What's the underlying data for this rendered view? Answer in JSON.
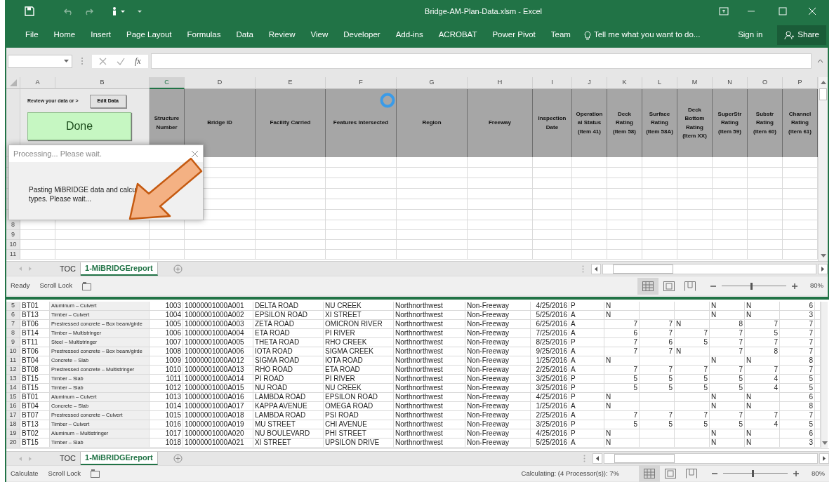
{
  "window": {
    "title": "Bridge-AM-Plan-Data.xlsm - Excel"
  },
  "ribbon": {
    "tabs": [
      "File",
      "Home",
      "Insert",
      "Page Layout",
      "Formulas",
      "Data",
      "Review",
      "View",
      "Developer",
      "Add-ins",
      "ACROBAT",
      "Power Pivot",
      "Team"
    ],
    "tell_me": "Tell me what you want to do...",
    "sign_in": "Sign in",
    "share": "Share"
  },
  "formula_bar": {
    "fx": "fx"
  },
  "top_sheet": {
    "columns": [
      {
        "letter": "A",
        "selected": false
      },
      {
        "letter": "B",
        "selected": false
      },
      {
        "letter": "C",
        "selected": true
      },
      {
        "letter": "D",
        "selected": false
      },
      {
        "letter": "E",
        "selected": false
      },
      {
        "letter": "F",
        "selected": false
      },
      {
        "letter": "G",
        "selected": false
      },
      {
        "letter": "H",
        "selected": false
      },
      {
        "letter": "I",
        "selected": false
      },
      {
        "letter": "J",
        "selected": false
      },
      {
        "letter": "K",
        "selected": false
      },
      {
        "letter": "L",
        "selected": false
      },
      {
        "letter": "M",
        "selected": false
      },
      {
        "letter": "N",
        "selected": false
      },
      {
        "letter": "O",
        "selected": false
      },
      {
        "letter": "P",
        "selected": false
      }
    ],
    "review_label": "Review your data or >",
    "edit_button": "Edit Data",
    "done_button": "Done",
    "headers": [
      {
        "lines": [
          "Structure",
          "Number"
        ]
      },
      {
        "lines": [
          "Bridge ID"
        ]
      },
      {
        "lines": [
          "Facility Carried"
        ]
      },
      {
        "lines": [
          "Features Intersected"
        ]
      },
      {
        "lines": [
          "Region"
        ]
      },
      {
        "lines": [
          "Freeway"
        ]
      },
      {
        "lines": [
          "Inspection",
          "Date"
        ]
      },
      {
        "lines": [
          "Operation",
          "al Status",
          "(Item 41)"
        ]
      },
      {
        "lines": [
          "Deck",
          "Rating",
          "(Item 58)"
        ]
      },
      {
        "lines": [
          "Surface",
          "Rating",
          "(Item 58A)"
        ]
      },
      {
        "lines": [
          "Deck",
          "Bottom",
          "Rating",
          "(Item XX)"
        ]
      },
      {
        "lines": [
          "SuperStr",
          "Rating",
          "(Item 59)"
        ]
      },
      {
        "lines": [
          "Substr",
          "Rating",
          "(Item 60)"
        ]
      },
      {
        "lines": [
          "Channel",
          "Rating",
          "(Item 61)"
        ]
      }
    ],
    "row_numbers": [
      "8",
      "9",
      "10",
      "11"
    ]
  },
  "dialog": {
    "title": "Processing... Please wait.",
    "lines": [
      "Pasting MiBRIDGE data and calcu",
      "types. Please wait..."
    ]
  },
  "top_tabs": [
    {
      "label": "TOC",
      "selected": false
    },
    {
      "label": "1-MiBRIDGEreport",
      "selected": true
    }
  ],
  "top_status": {
    "items": [
      "Ready",
      "Scroll Lock"
    ],
    "views": [
      {
        "kind": "normal",
        "selected": true
      },
      {
        "kind": "page_layout",
        "selected": false
      },
      {
        "kind": "page_break",
        "selected": false
      }
    ],
    "zoom": {
      "level": 0.45,
      "reading": "80%"
    }
  },
  "bottom_sheet": {
    "rows": [
      {
        "row": "5",
        "A": "BT01",
        "B": "Aluminum – Culvert",
        "C": "1003",
        "D": "10000001000A001",
        "E": "DELTA ROAD",
        "F": "NU CREEK",
        "G": "Northnorthwest",
        "H": "Non-Freeway",
        "I": "4/25/2016",
        "J": "P",
        "K": "N",
        "N": "N",
        "O": "N",
        "P": "6"
      },
      {
        "row": "6",
        "A": "BT13",
        "B": "Timber – Culvert",
        "C": "1004",
        "D": "10000001000A002",
        "E": "EPSILON ROAD",
        "F": "XI STREET",
        "G": "Northnorthwest",
        "H": "Non-Freeway",
        "I": "5/25/2016",
        "J": "A",
        "K": "N",
        "N": "N",
        "O": "N",
        "P": "3"
      },
      {
        "row": "7",
        "A": "BT06",
        "B": "Prestressed concrete – Box beam/girde",
        "C": "1005",
        "D": "10000001000A003",
        "E": "ZETA ROAD",
        "F": "OMICRON RIVER",
        "G": "Northnorthwest",
        "H": "Non-Freeway",
        "I": "6/25/2016",
        "J": "A",
        "K": "7",
        "L": "7",
        "M": "N",
        "N": "8",
        "O": "7",
        "P": "7"
      },
      {
        "row": "8",
        "A": "BT14",
        "B": "Timber – Multistringer",
        "C": "1006",
        "D": "10000001000A004",
        "E": "ETA ROAD",
        "F": "PI RIVER",
        "G": "Northnorthwest",
        "H": "Non-Freeway",
        "I": "7/25/2016",
        "J": "A",
        "K": "6",
        "L": "7",
        "M": "7",
        "N": "7",
        "O": "5",
        "P": "7"
      },
      {
        "row": "9",
        "A": "BT11",
        "B": "Steel – Multistringer",
        "C": "1007",
        "D": "10000001000A005",
        "E": "THETA ROAD",
        "F": "RHO CREEK",
        "G": "Northnorthwest",
        "H": "Non-Freeway",
        "I": "8/25/2016",
        "J": "P",
        "K": "7",
        "L": "6",
        "M": "5",
        "N": "7",
        "O": "7",
        "P": "7"
      },
      {
        "row": "10",
        "A": "BT06",
        "B": "Prestressed concrete – Box beam/girde",
        "C": "1008",
        "D": "10000001000A006",
        "E": "IOTA ROAD",
        "F": "SIGMA CREEK",
        "G": "Northnorthwest",
        "H": "Non-Freeway",
        "I": "9/25/2016",
        "J": "A",
        "K": "7",
        "L": "7",
        "M": "N",
        "N": "7",
        "O": "8",
        "P": "7"
      },
      {
        "row": "11",
        "A": "BT04",
        "B": "Concrete – Slab",
        "C": "1009",
        "D": "10000001000A012",
        "E": "SIGMA ROAD",
        "F": "IOTA ROAD",
        "G": "Northnorthwest",
        "H": "Non-Freeway",
        "I": "1/25/2016",
        "J": "A",
        "K": "N",
        "N": "N",
        "O": "N",
        "P": "8"
      },
      {
        "row": "12",
        "A": "BT08",
        "B": "Prestressed concrete – Multistringer",
        "C": "1010",
        "D": "10000001000A013",
        "E": "RHO ROAD",
        "F": "ETA ROAD",
        "G": "Northnorthwest",
        "H": "Non-Freeway",
        "I": "2/25/2016",
        "J": "A",
        "K": "7",
        "L": "7",
        "M": "7",
        "N": "7",
        "O": "7",
        "P": "7"
      },
      {
        "row": "13",
        "A": "BT15",
        "B": "Timber – Slab",
        "C": "1011",
        "D": "10000001000A014",
        "E": "PI ROAD",
        "F": "PI RIVER",
        "G": "Northnorthwest",
        "H": "Non-Freeway",
        "I": "3/25/2016",
        "J": "P",
        "K": "5",
        "L": "5",
        "M": "5",
        "N": "5",
        "O": "4",
        "P": "5"
      },
      {
        "row": "14",
        "A": "BT15",
        "B": "Timber – Slab",
        "C": "1012",
        "D": "10000001000A015",
        "E": "NU ROAD",
        "F": "NU CREEK",
        "G": "Northnorthwest",
        "H": "Non-Freeway",
        "I": "3/25/2016",
        "J": "P",
        "K": "5",
        "L": "5",
        "M": "5",
        "N": "5",
        "O": "4",
        "P": "5"
      },
      {
        "row": "15",
        "A": "BT01",
        "B": "Aluminum – Culvert",
        "C": "1013",
        "D": "10000001000A016",
        "E": "LAMBDA ROAD",
        "F": "EPSILON ROAD",
        "G": "Northnorthwest",
        "H": "Non-Freeway",
        "I": "4/25/2016",
        "J": "P",
        "K": "N",
        "N": "N",
        "O": "N",
        "P": "6"
      },
      {
        "row": "16",
        "A": "BT04",
        "B": "Concrete – Slab",
        "C": "1014",
        "D": "10000001000A017",
        "E": "KAPPA AVENUE",
        "F": "OMEGA ROAD",
        "G": "Northnorthwest",
        "H": "Non-Freeway",
        "I": "1/25/2016",
        "J": "A",
        "K": "N",
        "N": "N",
        "O": "N",
        "P": "8"
      },
      {
        "row": "17",
        "A": "BT07",
        "B": "Prestressed concrete – Culvert",
        "C": "1015",
        "D": "10000001000A018",
        "E": "LAMBDA ROAD",
        "F": "PSI ROAD",
        "G": "Northnorthwest",
        "H": "Non-Freeway",
        "I": "2/25/2016",
        "J": "A",
        "K": "7",
        "L": "7",
        "M": "7",
        "N": "7",
        "O": "7",
        "P": "7"
      },
      {
        "row": "18",
        "A": "BT13",
        "B": "Timber – Culvert",
        "C": "1016",
        "D": "10000001000A019",
        "E": "MU STREET",
        "F": "CHI AVENUE",
        "G": "Northnorthwest",
        "H": "Non-Freeway",
        "I": "3/25/2016",
        "J": "P",
        "K": "5",
        "L": "5",
        "M": "5",
        "N": "5",
        "O": "4",
        "P": "5"
      },
      {
        "row": "19",
        "A": "BT02",
        "B": "Aluminum – Multistringer",
        "C": "1017",
        "D": "10000001000A020",
        "E": "NU BOULEVARD",
        "F": "PHI STREET",
        "G": "Northnorthwest",
        "H": "Non-Freeway",
        "I": "4/25/2016",
        "J": "P",
        "K": "N",
        "N": "N",
        "O": "N",
        "P": "6"
      },
      {
        "row": "20",
        "A": "BT15",
        "B": "Timber – Slab",
        "C": "1018",
        "D": "10000001000A021",
        "E": "XI STREET",
        "F": "UPSILON DRIVE",
        "G": "Northnorthwest",
        "H": "Non-Freeway",
        "I": "5/25/2016",
        "J": "A",
        "K": "N",
        "N": "N",
        "O": "N",
        "P": "3"
      }
    ]
  },
  "bottom_tabs": [
    {
      "label": "TOC",
      "selected": false
    },
    {
      "label": "1-MiBRIDGEreport",
      "selected": true
    }
  ],
  "bottom_status": {
    "items": [
      "Calculate",
      "Scroll Lock"
    ],
    "message": "Calculating: (4 Processor(s)): 7%",
    "views": [
      {
        "kind": "normal",
        "selected": true
      },
      {
        "kind": "page_layout",
        "selected": false
      },
      {
        "kind": "page_break",
        "selected": false
      }
    ],
    "zoom": {
      "level": 0.45,
      "reading": "80%"
    }
  }
}
